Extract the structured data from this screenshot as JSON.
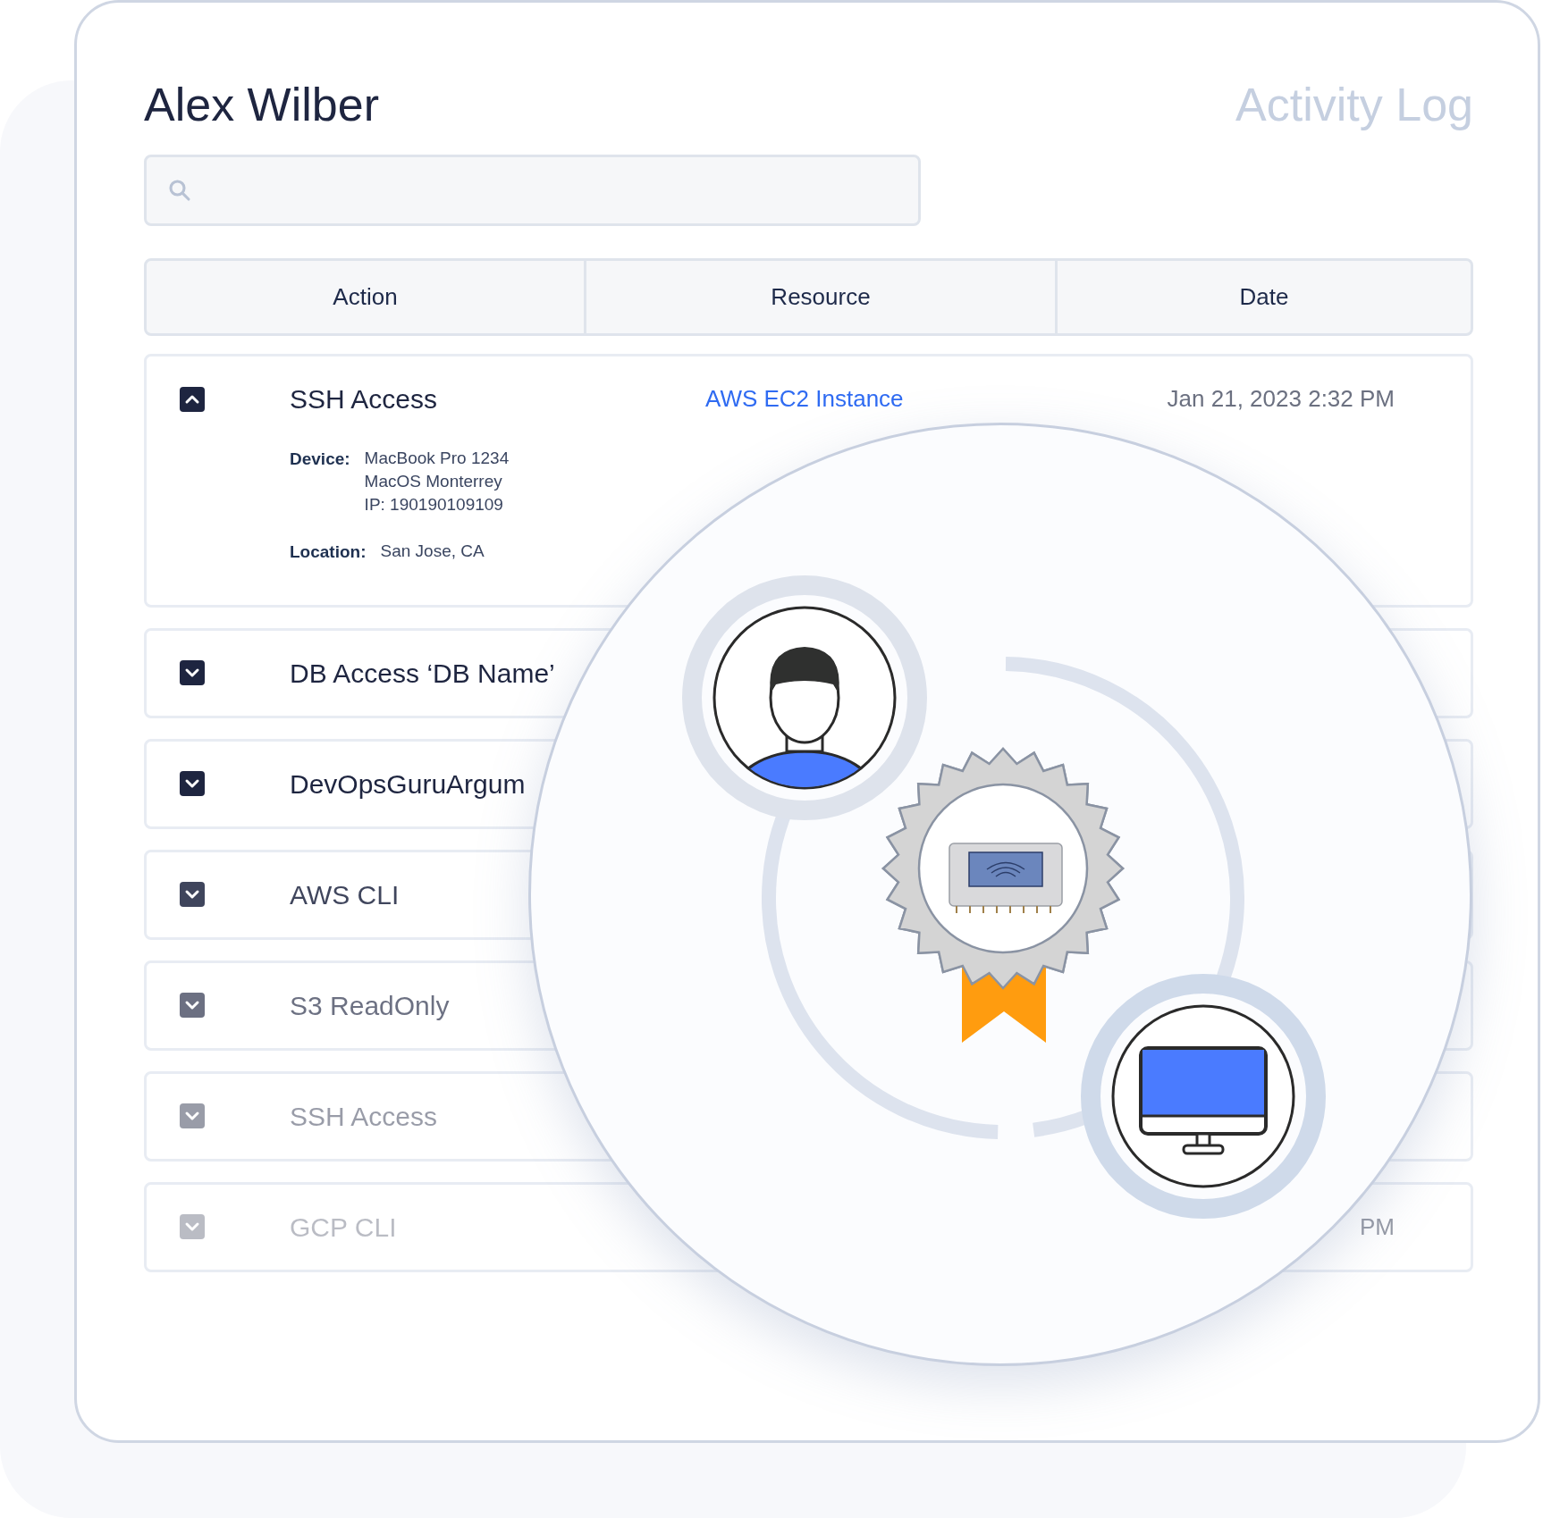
{
  "user_name": "Alex Wilber",
  "page_title": "Activity Log",
  "table": {
    "columns": [
      "Action",
      "Resource",
      "Date"
    ],
    "rows": [
      {
        "action": "SSH Access",
        "resource": "AWS EC2 Instance",
        "date": "Jan 21, 2023 2:32 PM",
        "expanded": true,
        "details": [
          {
            "label": "Device:",
            "lines": [
              "MacBook Pro 1234",
              "MacOS Monterrey",
              "IP: 190190109109"
            ]
          },
          {
            "label": "Location:",
            "lines": [
              "San Jose, CA"
            ]
          }
        ]
      },
      {
        "action": "DB Access ‘DB Name’",
        "expanded": false
      },
      {
        "action": "DevOpsGuruArgum",
        "expanded": false
      },
      {
        "action": "AWS CLI",
        "expanded": false
      },
      {
        "action": "S3 ReadOnly",
        "expanded": false
      },
      {
        "action": "SSH Access",
        "expanded": false
      },
      {
        "action": "GCP CLI",
        "date": "PM",
        "expanded": false
      }
    ]
  }
}
